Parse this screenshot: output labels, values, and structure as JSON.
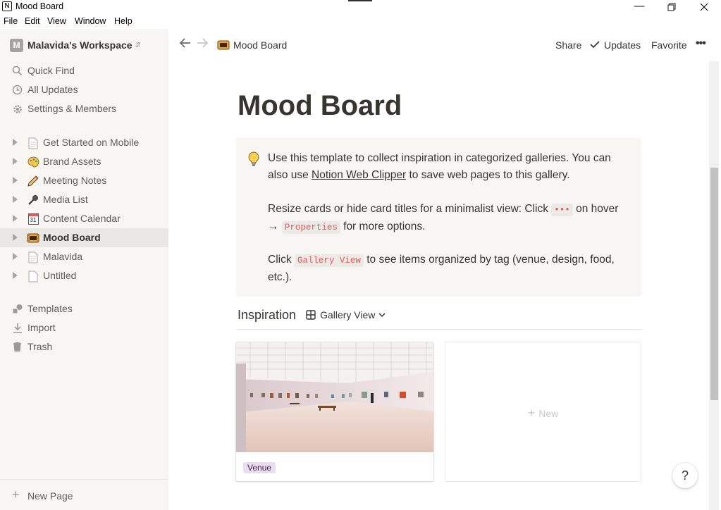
{
  "window": {
    "title": "Mood Board",
    "app_icon": "N",
    "controls": [
      "minimize-icon",
      "restore-icon",
      "close-icon"
    ]
  },
  "menu": [
    "File",
    "Edit",
    "View",
    "Window",
    "Help"
  ],
  "sidebar": {
    "workspace": {
      "avatar": "M",
      "name": "Malavida's Workspace"
    },
    "actions": [
      {
        "label": "Quick Find",
        "icon": "search-icon"
      },
      {
        "label": "All Updates",
        "icon": "clock-icon"
      },
      {
        "label": "Settings & Members",
        "icon": "gear-icon"
      }
    ],
    "pages": [
      {
        "label": "Get Started on Mobile",
        "icon": "document-icon"
      },
      {
        "label": "Brand Assets",
        "icon": "palette-icon"
      },
      {
        "label": "Meeting Notes",
        "icon": "pencil-icon"
      },
      {
        "label": "Media List",
        "icon": "microphone-icon"
      },
      {
        "label": "Content Calendar",
        "icon": "calendar-icon",
        "icon_text": "31"
      },
      {
        "label": "Mood Board",
        "icon": "film-strip-icon",
        "active": true
      },
      {
        "label": "Malavida",
        "icon": "document-icon"
      },
      {
        "label": "Untitled",
        "icon": "document-icon"
      }
    ],
    "tools": [
      {
        "label": "Templates",
        "icon": "shapes-icon"
      },
      {
        "label": "Import",
        "icon": "download-icon"
      },
      {
        "label": "Trash",
        "icon": "trash-icon"
      }
    ],
    "new_page": "New Page"
  },
  "topbar": {
    "breadcrumb": "Mood Board",
    "share": "Share",
    "updates": "Updates",
    "favorite": "Favorite",
    "more": "•••"
  },
  "page": {
    "title": "Mood Board",
    "callout": {
      "icon": "lightbulb-icon",
      "p1_before": "Use this template to collect inspiration in categorized galleries. You can also use ",
      "p1_link": "Notion Web Clipper",
      "p1_after": " to save web pages to this gallery.",
      "p2_before": "Resize cards or hide card titles for a minimalist view: Click ",
      "p2_code1": "•••",
      "p2_mid": " on hover → ",
      "p2_code2": "Properties",
      "p2_after": " for more options.",
      "p3_before": "Click ",
      "p3_code": "Gallery View",
      "p3_after": " to see items organized by tag (venue, design, food, etc.)."
    },
    "database": {
      "title": "Inspiration",
      "view": "Gallery View",
      "cards": [
        {
          "tag": "Venue"
        }
      ],
      "new_label": "New"
    }
  },
  "help": "?",
  "colors": {
    "sidebar_bg": "#f7f6f3",
    "text": "#37352f",
    "muted": "#5f5e5b",
    "code_red": "#eb5757",
    "tag_bg": "#e8deee"
  }
}
